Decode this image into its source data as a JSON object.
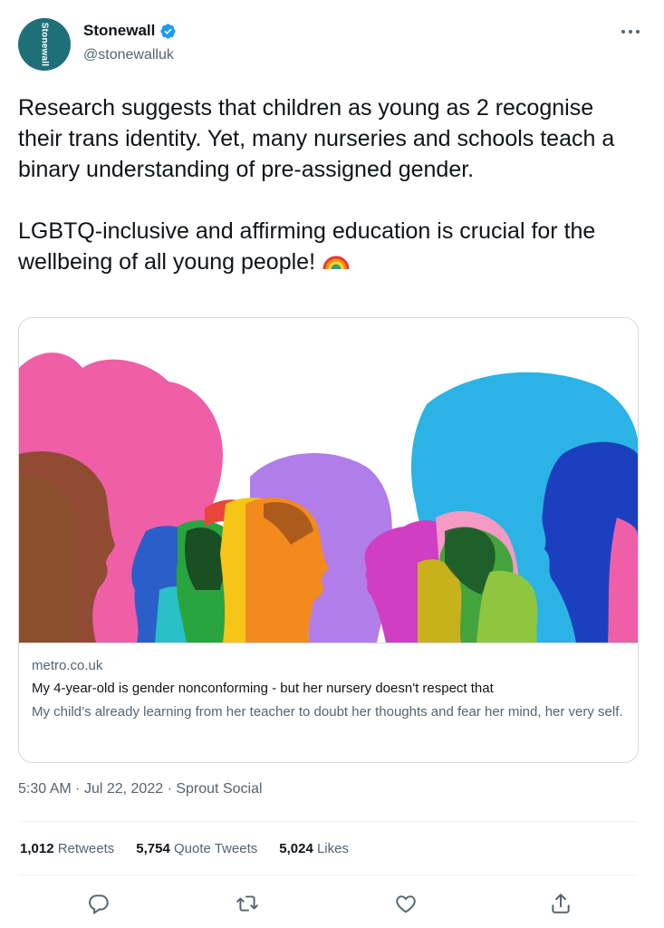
{
  "author": {
    "avatar_text": "Stonewall",
    "display_name": "Stonewall",
    "handle": "@stonewalluk",
    "verified_icon": "verified-badge-icon",
    "brand_color": "#1f6f78"
  },
  "tweet": {
    "paragraph_1": "Research suggests that children as young as 2 recognise their trans identity. Yet, many nurseries and schools teach a binary understanding of pre-assigned gender.",
    "paragraph_2": "LGBTQ-inclusive and affirming education is crucial for the wellbeing of all young people!",
    "emoji": "rainbow-emoji"
  },
  "card": {
    "domain": "metro.co.uk",
    "title": "My 4-year-old is gender nonconforming - but her nursery doesn't respect that",
    "description": "My child’s already learning from her teacher to doubt her thoughts and fear her mind, her very self."
  },
  "meta": {
    "time": "5:30 AM",
    "date": "Jul 22, 2022",
    "source": "Sprout Social",
    "separator": "·"
  },
  "stats": {
    "retweets_count": "1,012",
    "retweets_label": "Retweets",
    "quotes_count": "5,754",
    "quotes_label": "Quote Tweets",
    "likes_count": "5,024",
    "likes_label": "Likes"
  },
  "actions": [
    "reply-icon",
    "retweet-icon",
    "like-icon",
    "share-icon"
  ],
  "colors": {
    "text_primary": "#0f1419",
    "text_secondary": "#536471",
    "verified_blue": "#1d9bf0",
    "border": "#cfd9de"
  }
}
